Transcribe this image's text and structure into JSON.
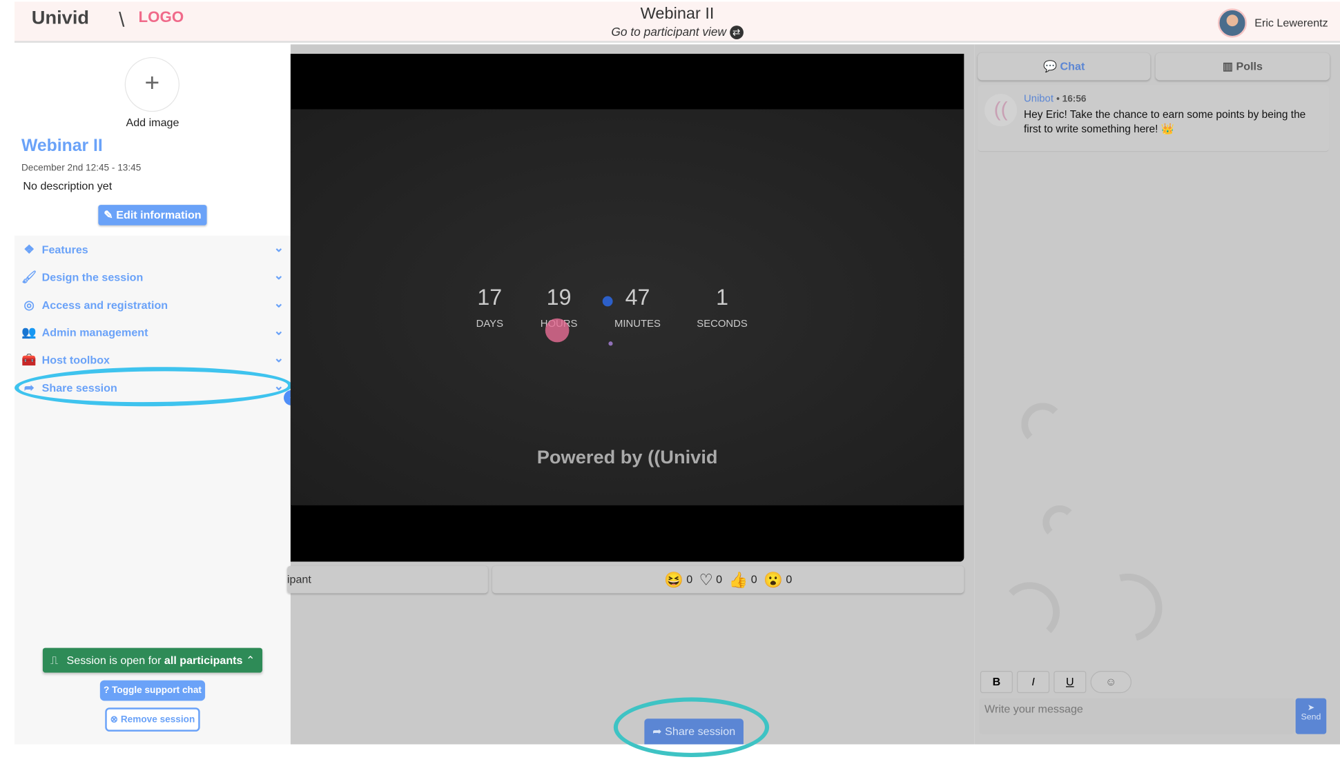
{
  "header": {
    "logo": "Univid",
    "brand_logo": "LOGO",
    "title": "Webinar II",
    "subtitle": "Go to participant view",
    "user_name": "Eric Lewerentz"
  },
  "sidebar": {
    "add_image": "Add image",
    "title": "Webinar II",
    "date": "December 2nd 12:45 - 13:45",
    "description": "No description yet",
    "edit_button": "Edit information",
    "items": [
      {
        "label": "Features",
        "icon": "cubes-icon"
      },
      {
        "label": "Design the session",
        "icon": "brush-icon"
      },
      {
        "label": "Access and registration",
        "icon": "fingerprint-icon"
      },
      {
        "label": "Admin management",
        "icon": "users-icon"
      },
      {
        "label": "Host toolbox",
        "icon": "toolbox-icon"
      },
      {
        "label": "Share session",
        "icon": "share-icon"
      }
    ],
    "open_prefix": "Session is open for ",
    "open_strong": "all participants",
    "toggle_support": "Toggle support chat",
    "remove_session": "Remove session"
  },
  "countdown": {
    "days": "17",
    "days_label": "DAYS",
    "hours": "19",
    "hours_label": "HOURS",
    "minutes": "47",
    "minutes_label": "MINUTES",
    "seconds": "1",
    "seconds_label": "SECONDS"
  },
  "powered_by": "Powered by",
  "powered_logo": "Univid",
  "bottom_bar": {
    "left_text": "ipant",
    "reactions": [
      {
        "icon": "laugh-icon",
        "glyph": "😆",
        "count": "0"
      },
      {
        "icon": "heart-icon",
        "glyph": "♡",
        "count": "0"
      },
      {
        "icon": "thumbs-up-icon",
        "glyph": "👍",
        "count": "0"
      },
      {
        "icon": "surprised-icon",
        "glyph": "😮",
        "count": "0"
      }
    ]
  },
  "share_button": "Share session",
  "chat": {
    "tabs": [
      {
        "label": "Chat",
        "color": "#5b86d4"
      },
      {
        "label": "Polls",
        "color": "#555555"
      }
    ],
    "message": {
      "author": "Unibot",
      "time": "16:56",
      "text": "Hey Eric! Take the chance to earn some points by being the first to write something here! 👑"
    },
    "format": {
      "bold": "B",
      "italic": "I",
      "underline": "U",
      "emoji": "☺"
    },
    "placeholder": "Write your message",
    "send": "Send"
  },
  "colors": {
    "accent": "#6aa2f8",
    "success": "#2e8b57",
    "header_bg": "#fdf3f2"
  }
}
